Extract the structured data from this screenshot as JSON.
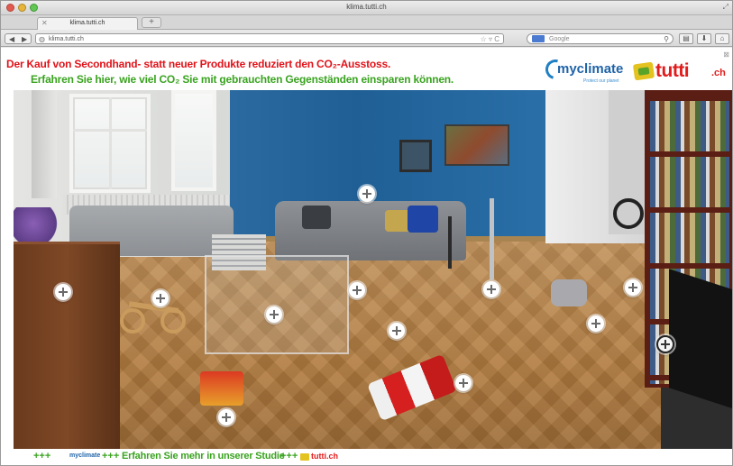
{
  "browser": {
    "window_title": "klima.tutti.ch",
    "tab_label": "klima.tutti.ch",
    "new_tab_label": "+",
    "url": "klima.tutti.ch",
    "search_placeholder": "Google",
    "back_glyph": "◀",
    "forward_glyph": "▶",
    "globe_icon": "globe-icon",
    "url_icons_glyph": "☆ ▿ C",
    "search_glyph": "⚲",
    "toolbar_buttons": [
      "▤",
      "⬇",
      "⌂"
    ],
    "close_glyph": "✕",
    "resize_glyph": "⤢"
  },
  "header": {
    "headline_red": "Der Kauf von Secondhand- statt neuer Produkte reduziert den CO₂-Ausstoss.",
    "headline_green": "Erfahren Sie hier, wie viel CO₂ Sie mit gebrauchten Gegenständen einsparen können.",
    "myclimate_logo": "myclimate",
    "myclimate_tagline": "Protect our planet",
    "tutti_logo": "tutti",
    "tutti_suffix": ".ch",
    "close_glyph": "⊠"
  },
  "scene": {
    "hotspot_glyph": "+",
    "hotspot_count": 14,
    "pan_left_glyph": "<",
    "pan_right_glyph": ">"
  },
  "footer": {
    "plus_1": "+++",
    "myclimate_small": "myclimate",
    "plus_2": "+++",
    "cta": "+++ Erfahren Sie mehr in unserer Studie +++",
    "tutti_small": "tutti.ch"
  },
  "colors": {
    "headline_red": "#e0131a",
    "headline_green": "#39a31f",
    "myclimate_blue": "#1f63a8",
    "tutti_red": "#e21b1b",
    "wall_blue": "#1f5f95"
  }
}
